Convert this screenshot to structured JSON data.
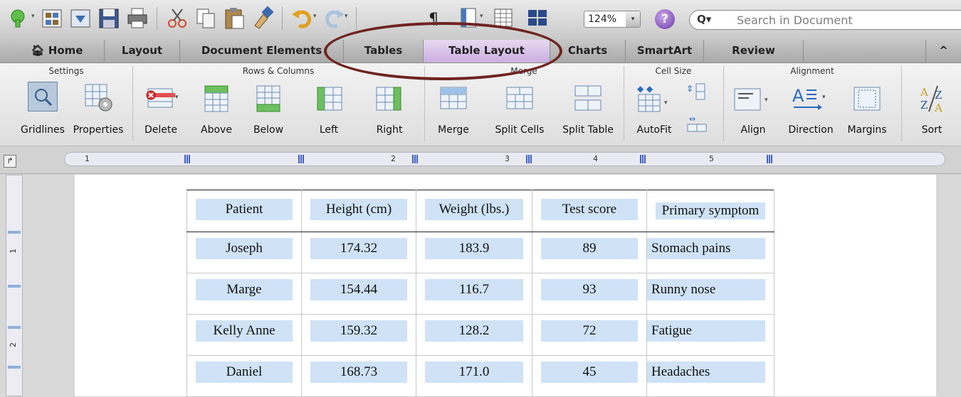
{
  "toolbar": {
    "zoom": "124%",
    "help_label": "?",
    "search_prefix": "Q▾",
    "search_placeholder": "Search in Document"
  },
  "tabs": [
    {
      "label": "Home"
    },
    {
      "label": "Layout"
    },
    {
      "label": "Document Elements"
    },
    {
      "label": "Tables"
    },
    {
      "label": "Table Layout",
      "active": true
    },
    {
      "label": "Charts"
    },
    {
      "label": "SmartArt"
    },
    {
      "label": "Review"
    }
  ],
  "ribbon": {
    "groups": {
      "settings": "Settings",
      "rows_columns": "Rows & Columns",
      "merge": "Merge",
      "cell_size": "Cell Size",
      "alignment": "Alignment"
    },
    "buttons": {
      "gridlines": "Gridlines",
      "properties": "Properties",
      "delete": "Delete",
      "above": "Above",
      "below": "Below",
      "left": "Left",
      "right": "Right",
      "merge": "Merge",
      "split_cells": "Split Cells",
      "split_table": "Split Table",
      "autofit": "AutoFit",
      "align": "Align",
      "direction": "Direction",
      "margins": "Margins",
      "sort": "Sort"
    }
  },
  "ruler": {
    "numbers": [
      "1",
      "2",
      "3",
      "4",
      "5"
    ],
    "vertical_numbers": [
      "1",
      "2"
    ]
  },
  "table": {
    "headers": [
      "Patient",
      "Height (cm)",
      "Weight (lbs.)",
      "Test score",
      "Primary symptom"
    ],
    "rows": [
      [
        "Joseph",
        "174.32",
        "183.9",
        "89",
        "Stomach pains"
      ],
      [
        "Marge",
        "154.44",
        "116.7",
        "93",
        "Runny nose"
      ],
      [
        "Kelly Anne",
        "159.32",
        "128.2",
        "72",
        "Fatigue"
      ],
      [
        "Daniel",
        "168.73",
        "171.0",
        "45",
        "Headaches"
      ]
    ]
  },
  "colors": {
    "active_tab": "#c9aee0",
    "cell_shading": "#cfe2f6",
    "annotation_ellipse": "#6e2420"
  }
}
